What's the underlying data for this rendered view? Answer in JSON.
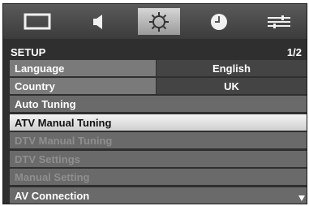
{
  "tabs": [
    {
      "icon": "picture-icon"
    },
    {
      "icon": "sound-icon"
    },
    {
      "icon": "setup-gear-icon",
      "active": true
    },
    {
      "icon": "clock-icon"
    },
    {
      "icon": "options-sliders-icon"
    }
  ],
  "header": {
    "title": "SETUP",
    "page": "1/2"
  },
  "menu": {
    "language": {
      "label": "Language",
      "value": "English"
    },
    "country": {
      "label": "Country",
      "value": "UK"
    },
    "auto_tuning": "Auto Tuning",
    "atv_manual_tuning": "ATV Manual Tuning",
    "dtv_manual_tuning": "DTV Manual Tuning",
    "dtv_settings": "DTV Settings",
    "manual_setting": "Manual Setting",
    "av_connection": "AV Connection"
  },
  "colors": {
    "panel": "#2f2f2f",
    "row": "#6a6a6a",
    "selected": "#e6e6e6",
    "disabled_text": "#8e8e8e"
  }
}
